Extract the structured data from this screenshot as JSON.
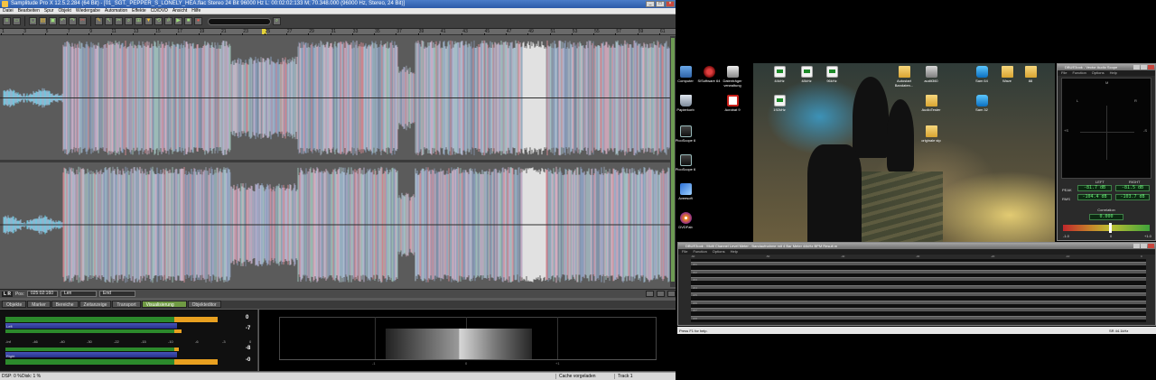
{
  "samplitude": {
    "title": "Samplitude Pro X 12.5.2.284 (64 Bit) - [01_SGT._PEPPER_S_LONELY_HEA.flac  Stereo 24 Bit 96000 Hz L: 00:02:02:133 M; 70.348.000  (96000 Hz, Stereo, 24 Bit)]",
    "menu": [
      "Datei",
      "Bearbeiten",
      "Spur",
      "Objekt",
      "Wiedergabe",
      "Automation",
      "Effekte",
      "CD/DVD",
      "Ansicht",
      "Hilfe"
    ],
    "ruler_ticks": [
      "1",
      "3",
      "5",
      "7",
      "9",
      "11",
      "13",
      "15",
      "17",
      "19",
      "21",
      "23",
      "25",
      "27",
      "29",
      "31",
      "33",
      "35",
      "37",
      "39",
      "41",
      "43",
      "45",
      "47",
      "49",
      "51",
      "53",
      "55",
      "57",
      "59",
      "61"
    ],
    "status": {
      "lr": "L R",
      "pos_label": "Pos:",
      "pos_value": "025:02:160",
      "len_label": "Len",
      "end_label": "End"
    },
    "tabs": [
      "Objekte",
      "Marker",
      "Bereiche",
      "Zeitanzeige",
      "Transport",
      "Visualisierung",
      "Objekteditor"
    ],
    "active_tab": "Visualisierung",
    "meter": {
      "left_label": "Left",
      "right_label": "Right",
      "scale": [
        "-Inf",
        "-46",
        "-40",
        "-30",
        "-22",
        "-15",
        "-10",
        "-6",
        "-3",
        "0"
      ],
      "left_peak_top": "0",
      "left_peak_bottom": "-7",
      "right_peak_top": "-8",
      "right_peak_bottom": "-0"
    },
    "vis_scale": [
      "-1",
      "0",
      "+1"
    ],
    "statusbar": {
      "dsp": "DSP: 0 %",
      "disk": "Disk:   1 %",
      "cache": "Cache vorgeladen",
      "track": "Track 1"
    }
  },
  "desktop": {
    "icons": [
      {
        "label": "Computer",
        "icon": "computer-icon"
      },
      {
        "label": "SiSoftware 64",
        "icon": "virus-icon"
      },
      {
        "label": "Datenträger verwaltung",
        "icon": "drive-icon"
      },
      {
        "label": "44kHz",
        "icon": "wav-file-icon"
      },
      {
        "label": "48kHz",
        "icon": "wav-file-icon"
      },
      {
        "label": "96kHz",
        "icon": "wav-file-icon"
      },
      {
        "label": "Autostart Bandaten...",
        "icon": "folder-icon"
      },
      {
        "label": "audit360",
        "icon": "audit-icon"
      },
      {
        "label": "Sam 64",
        "icon": "samplitude-icon"
      },
      {
        "label": "Wave",
        "icon": "folder-icon"
      },
      {
        "label": "88",
        "icon": "folder-icon"
      },
      {
        "label": "Papierkorb",
        "icon": "recycle-bin-icon"
      },
      {
        "label": "Acrobat 9",
        "icon": "pdf-icon"
      },
      {
        "label": "192kHz",
        "icon": "wav-file-icon"
      },
      {
        "label": "AudioTester",
        "icon": "folder-icon"
      },
      {
        "label": "Sam 32",
        "icon": "samplitude-icon"
      },
      {
        "label": "PicoScope 6",
        "icon": "scope-icon"
      },
      {
        "label": "originale stp",
        "icon": "folder-icon"
      },
      {
        "label": "PicoScope 6",
        "icon": "scope-icon"
      },
      {
        "label": "Aveesoft",
        "icon": "avee-icon"
      },
      {
        "label": "DVDFab",
        "icon": "dvd-icon"
      }
    ],
    "goniometer": {
      "title": "DBUE3ook - Vector Audio Scope",
      "menu": [
        "File",
        "Function",
        "Options",
        "Help"
      ],
      "scope_labels": {
        "top": "M",
        "left": "L",
        "right": "R",
        "plus": "+S",
        "minus": "-S"
      },
      "left_label": "LEFT",
      "right_label": "RIGHT",
      "peak_label": "PEAK",
      "rms_label": "RMS",
      "left_peak": "-81.7 dB",
      "right_peak": "-81.5 dB",
      "left_rms": "-104.4 dB",
      "right_rms": "-103.7 dB",
      "corr_label": "Correlation",
      "corr_value": "0.000",
      "corr_min": "-1.0",
      "corr_mid": "0",
      "corr_max": "+1.0"
    },
    "level_meter": {
      "title": "DBUE3ook - Multi Channel Level Meter - Bandaufnahme mit 4 Bar Meter 44kHz BPM Result.m",
      "menu": [
        "File",
        "Function",
        "Options",
        "Help"
      ],
      "scale": [
        "-60",
        "-50",
        "-40",
        "-30",
        "-20",
        "-10",
        "0"
      ],
      "rows": [
        "ch1",
        "ch2",
        "ch3",
        "ch4",
        "ch5",
        "ch6",
        "ch7",
        "ch8"
      ]
    },
    "tray": {
      "help": "Press F1 for help.",
      "rate": "SR 44.1kHz"
    }
  }
}
